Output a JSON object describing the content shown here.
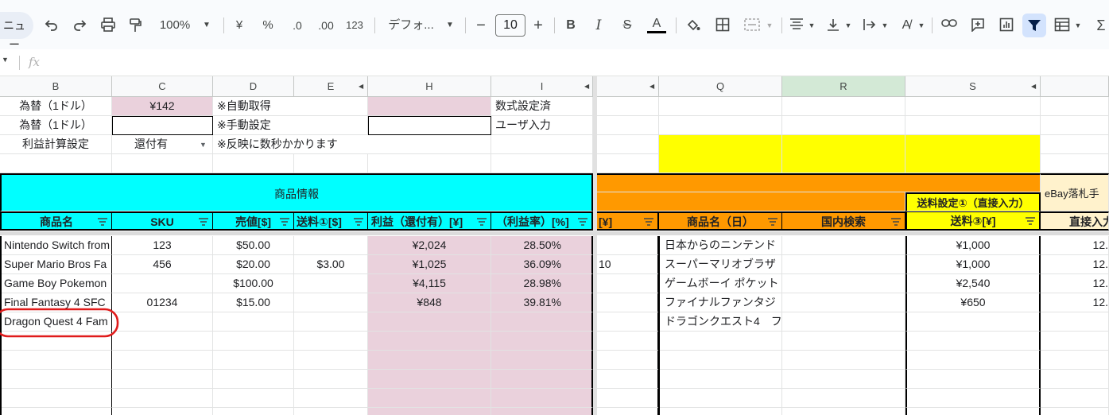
{
  "toolbar": {
    "menu_label": "ニュー",
    "zoom": "100%",
    "currency_label": "¥",
    "percent_label": "%",
    "dec_minus_label": ".0",
    "dec_plus_label": ".00",
    "number_format_label": "123",
    "font_name": "デフォ...",
    "font_size": "10",
    "bold_label": "B",
    "italic_label": "I",
    "text_color_label": "A",
    "text_color": "#000000",
    "sum_label": "Σ"
  },
  "formula_bar": {
    "fx_label": "fx",
    "value": ""
  },
  "column_headers": [
    "B",
    "C",
    "D",
    "E",
    "H",
    "I",
    "Q",
    "R",
    "S"
  ],
  "settings": {
    "row1": {
      "label": "為替（1ドル）",
      "value": "¥142",
      "note": "※自動取得",
      "legend": "数式設定済"
    },
    "row2": {
      "label": "為替（1ドル）",
      "value": "",
      "note": "※手動設定",
      "legend": "ユーザ入力"
    },
    "row3": {
      "label": "利益計算設定",
      "value": "還付有",
      "note": "※反映に数秒かかります"
    }
  },
  "section_headers": {
    "product_info": "商品情報",
    "shipping_setting": "送料設定①（直接入力）",
    "ebay_fee": "eBay落札手"
  },
  "table_headers": {
    "name": "商品名",
    "sku": "SKU",
    "price": "売値[$]",
    "shipping1": "送料①[$]",
    "profit": "利益（還付有）[¥]",
    "margin": "（利益率）[%]",
    "yen_col": "[¥]",
    "name_jp": "商品名（日）",
    "domestic_search": "国内検索",
    "shipping3": "送料③[¥]",
    "direct_input": "直接入力"
  },
  "rows": [
    {
      "name": "Nintendo Switch from",
      "sku": "123",
      "price": "$50.00",
      "shipping1": "",
      "profit": "¥2,024",
      "margin": "28.50%",
      "p": "",
      "name_jp": "日本からのニンテンド",
      "domestic": "",
      "shipping3": "¥1,000",
      "fee": "12."
    },
    {
      "name": "Super Mario Bros Fa",
      "sku": "456",
      "price": "$20.00",
      "shipping1": "$3.00",
      "profit": "¥1,025",
      "margin": "36.09%",
      "p": "10",
      "name_jp": "スーパーマリオブラザ",
      "domestic": "",
      "shipping3": "¥1,000",
      "fee": "12."
    },
    {
      "name": "Game Boy Pokemon",
      "sku": "",
      "price": "$100.00",
      "shipping1": "",
      "profit": "¥4,115",
      "margin": "28.98%",
      "p": "",
      "name_jp": "ゲームボーイ ポケット",
      "domestic": "",
      "shipping3": "¥2,540",
      "fee": "12."
    },
    {
      "name": "Final Fantasy 4 SFC",
      "sku": "01234",
      "price": "$15.00",
      "shipping1": "",
      "profit": "¥848",
      "margin": "39.81%",
      "p": "",
      "name_jp": "ファイナルファンタジ",
      "domestic": "",
      "shipping3": "¥650",
      "fee": "12."
    },
    {
      "name": "Dragon Quest 4 Fam",
      "sku": "",
      "price": "",
      "shipping1": "",
      "profit": "",
      "margin": "",
      "p": "",
      "name_jp": "ドラゴンクエスト4　フ",
      "domestic": "",
      "shipping3": "",
      "fee": ""
    }
  ],
  "colors": {
    "pink": "#ead1dc",
    "cyan": "#00ffff",
    "orange": "#ff9900",
    "yellow": "#ffff00",
    "cream": "#fff2cc",
    "annotation": "#e01b1b"
  }
}
